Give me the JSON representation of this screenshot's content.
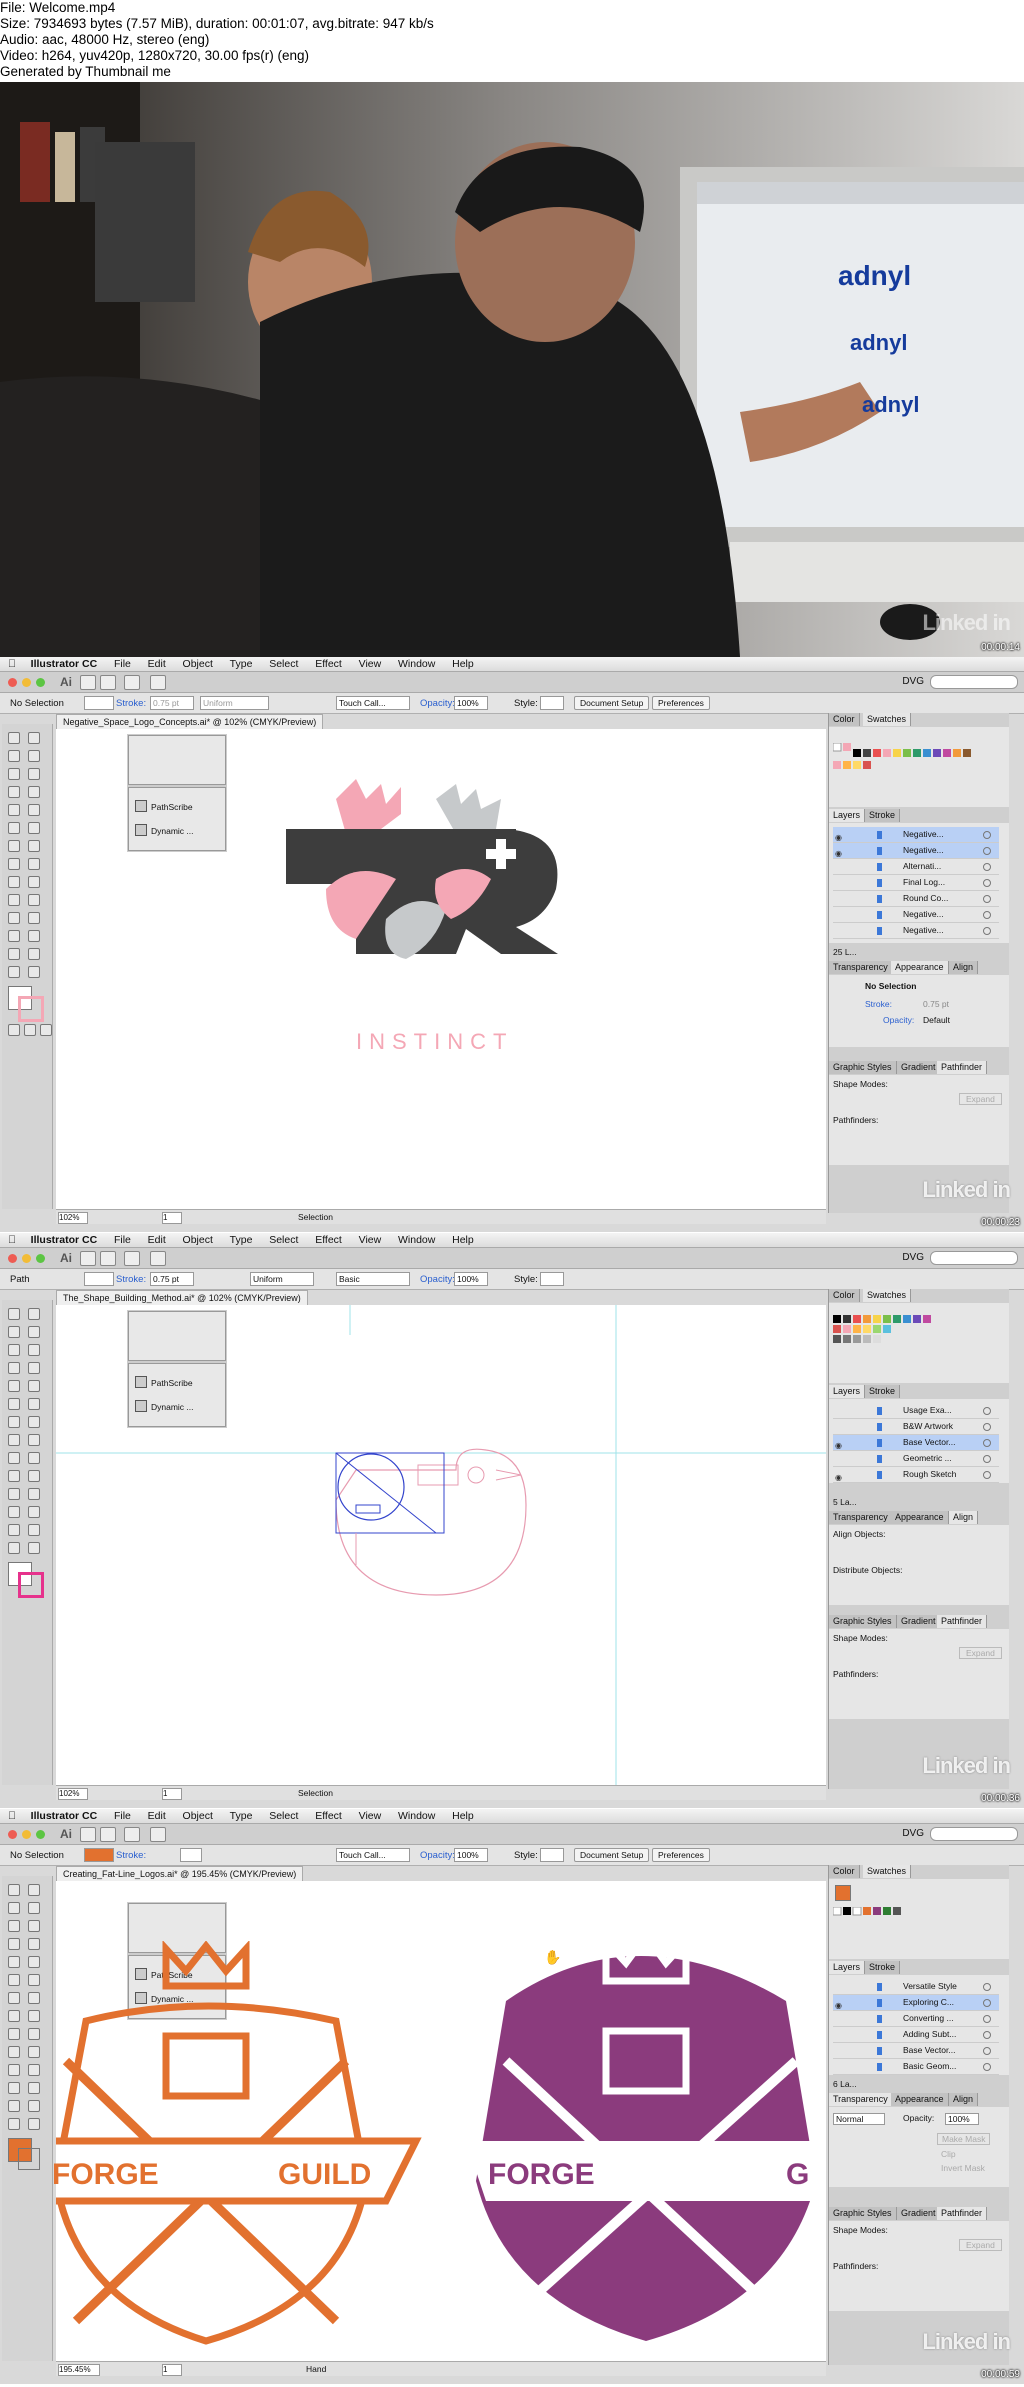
{
  "header": {
    "lines": [
      "File: Welcome.mp4",
      "Size: 7934693 bytes (7.57 MiB), duration: 00:01:07, avg.bitrate: 947 kb/s",
      "Audio: aac, 48000 Hz, stereo (eng)",
      "Video: h264, yuv420p, 1280x720, 30.00 fps(r) (eng)",
      "Generated by Thumbnail me"
    ]
  },
  "frame1": {
    "screen_logo": "adnyl",
    "watermark": "Linked in",
    "timestamp": "00:00:14"
  },
  "common": {
    "menu": [
      "Illustrator CC",
      "File",
      "Edit",
      "Object",
      "Type",
      "Select",
      "Effect",
      "View",
      "Window",
      "Help"
    ],
    "ai_logo": "Ai",
    "workspace": "DVG",
    "stroke_label": "Stroke:",
    "opacity_label": "Opacity:",
    "opacity_value": "100%",
    "style_label": "Style:",
    "doc_setup": "Document Setup",
    "preferences": "Preferences",
    "panel_tabs_top": [
      "Color",
      "Swatches"
    ],
    "panel_tabs_layers": [
      "Layers",
      "Stroke"
    ],
    "panel_tabs_app": [
      "Transparency",
      "Appearance",
      "Align"
    ],
    "panel_tabs_path": [
      "Graphic Styles",
      "Gradient",
      "Pathfinder"
    ],
    "shape_modes": "Shape Modes:",
    "pathfinders": "Pathfinders:",
    "expand": "Expand",
    "pathscribe": "PathScribe",
    "dynamic": "Dynamic ...",
    "watermark": "Linked in"
  },
  "frame2": {
    "selection_label": "No Selection",
    "stroke_weight": "0.75 pt",
    "profile": "Uniform",
    "brush": "Touch Call...",
    "tab_title": "Negative_Space_Logo_Concepts.ai* @ 102% (CMYK/Preview)",
    "logo_text": "INSTINCT",
    "zoom": "102%",
    "page": "1",
    "status_tool": "Selection",
    "layers": [
      {
        "name": "Negative...",
        "selected": true
      },
      {
        "name": "Negative...",
        "selected": true
      },
      {
        "name": "Alternati...",
        "selected": false
      },
      {
        "name": "Final Log...",
        "selected": false
      },
      {
        "name": "Round Co...",
        "selected": false
      },
      {
        "name": "Negative...",
        "selected": false
      },
      {
        "name": "Negative...",
        "selected": false
      }
    ],
    "layers_count": "25 L...",
    "appearance_title": "No Selection",
    "appearance_stroke": "Stroke:",
    "appearance_stroke_val": "0.75 pt",
    "appearance_opacity": "Opacity:",
    "appearance_opacity_val": "Default",
    "timestamp": "00:00:23"
  },
  "frame3": {
    "selection_label": "Path",
    "stroke_weight": "0.75 pt",
    "profile": "Uniform",
    "brush": "Basic",
    "tab_title": "The_Shape_Building_Method.ai* @ 102% (CMYK/Preview)",
    "zoom": "102%",
    "page": "1",
    "status_tool": "Selection",
    "layers": [
      {
        "name": "Usage Exa...",
        "selected": false
      },
      {
        "name": "B&W Artwork",
        "selected": false
      },
      {
        "name": "Base Vector...",
        "selected": true
      },
      {
        "name": "Geometric ...",
        "selected": false
      },
      {
        "name": "Rough Sketch",
        "selected": false
      }
    ],
    "layers_count": "5 La...",
    "align_objects": "Align Objects:",
    "distribute_objects": "Distribute Objects:",
    "timestamp": "00:00:36"
  },
  "frame4": {
    "selection_label": "No Selection",
    "brush": "Touch Call...",
    "tab_title": "Creating_Fat-Line_Logos.ai* @ 195.45% (CMYK/Preview)",
    "badge_left_a": "FORGE",
    "badge_left_b": "GUILD",
    "badge_right_a": "FORGE",
    "badge_right_b": "G",
    "zoom": "195.45%",
    "page": "1",
    "status_tool": "Hand",
    "layers": [
      {
        "name": "Versatile Style",
        "selected": false
      },
      {
        "name": "Exploring C...",
        "selected": true
      },
      {
        "name": "Converting ...",
        "selected": false
      },
      {
        "name": "Adding Subt...",
        "selected": false
      },
      {
        "name": "Base Vector...",
        "selected": false
      },
      {
        "name": "Basic Geom...",
        "selected": false
      }
    ],
    "layers_count": "6 La...",
    "blend_mode": "Normal",
    "opacity": "Opacity:",
    "opacity_value": "100%",
    "make_mask": "Make Mask",
    "clip": "Clip",
    "invert_mask": "Invert Mask",
    "timestamp": "00:00:59"
  },
  "colors": {
    "pink": "#f4a7b5",
    "dark_gray": "#3d3d3d",
    "light_gray": "#c6c9cb",
    "orange": "#e2712f",
    "purple": "#8b3b7d",
    "selection_blue": "#3344cc"
  }
}
